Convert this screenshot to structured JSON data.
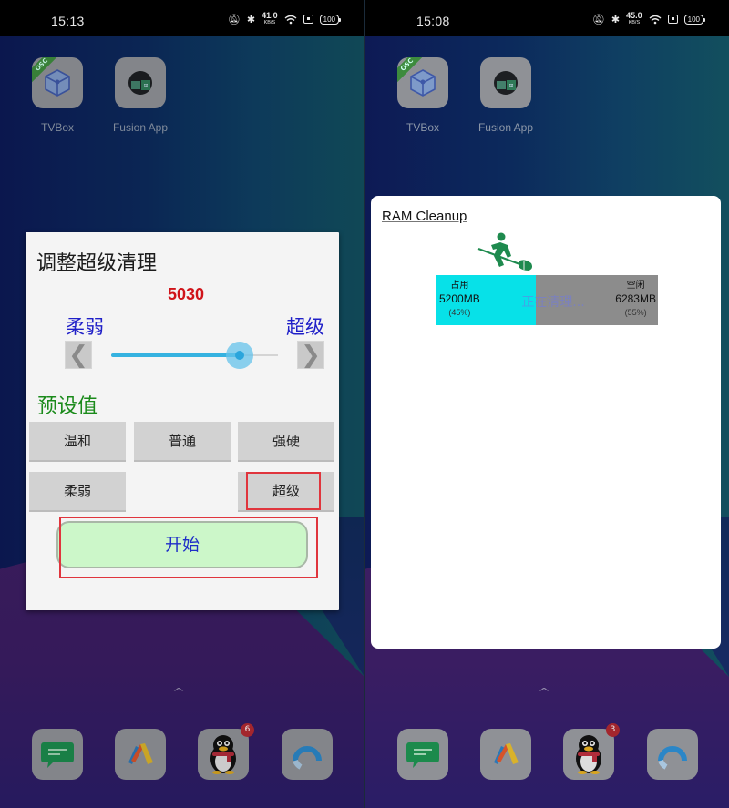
{
  "left_screen": {
    "statusbar": {
      "time": "15:13",
      "net_speed": "41.0",
      "net_unit": "KB/S",
      "battery": "100"
    },
    "home_apps": [
      {
        "label": "TVBox",
        "badge": "OSC"
      },
      {
        "label": "Fusion App"
      }
    ],
    "dock": [
      {
        "name": "messages",
        "badge": null
      },
      {
        "name": "app-2",
        "badge": null
      },
      {
        "name": "qq",
        "badge": "6"
      },
      {
        "name": "browser",
        "badge": null
      }
    ],
    "dialog": {
      "title": "调整超级清理",
      "value": "5030",
      "min_label": "柔弱",
      "max_label": "超级",
      "decrement_glyph": "❮",
      "increment_glyph": "❯",
      "slider_fraction": 0.77,
      "preset_heading": "预设值",
      "presets": [
        "温和",
        "普通",
        "强硬",
        "柔弱",
        "超级"
      ],
      "start_label": "开始",
      "highlight_color": "#e0353d"
    }
  },
  "right_screen": {
    "statusbar": {
      "time": "15:08",
      "net_speed": "45.0",
      "net_unit": "KB/S",
      "battery": "100"
    },
    "home_apps": [
      {
        "label": "TVBox",
        "badge": "OSC"
      },
      {
        "label": "Fusion App"
      }
    ],
    "dock": [
      {
        "name": "messages",
        "badge": null
      },
      {
        "name": "app-2",
        "badge": null
      },
      {
        "name": "qq",
        "badge": "3"
      },
      {
        "name": "browser",
        "badge": null
      }
    ],
    "ram_dialog": {
      "title": "RAM Cleanup",
      "status": "正在清理...",
      "used": {
        "label": "占用",
        "mb": "5200MB",
        "pct": "(45%)",
        "fraction": 0.45,
        "color": "#07e1e8"
      },
      "free": {
        "label": "空闲",
        "mb": "6283MB",
        "pct": "(55%)",
        "fraction": 0.55,
        "color": "#8c8c8c"
      }
    }
  }
}
